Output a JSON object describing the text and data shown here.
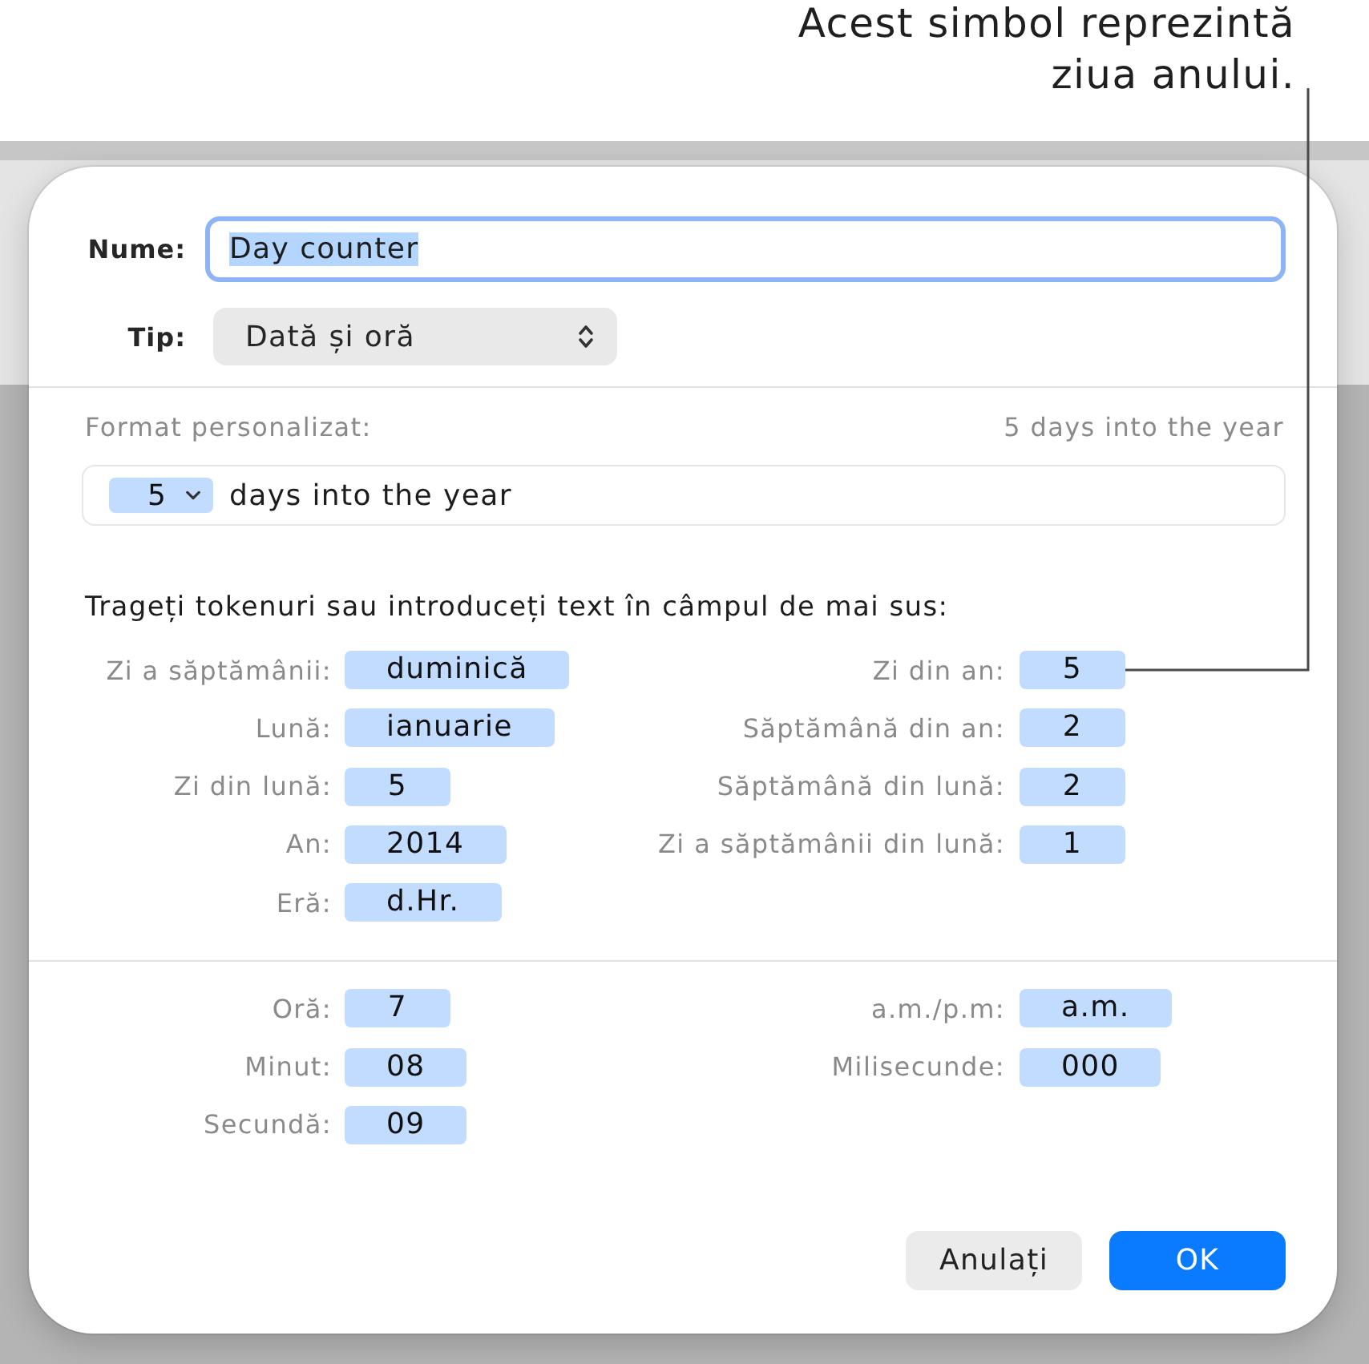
{
  "callout": {
    "text": "Acest simbol reprezintă ziua anului."
  },
  "dialog": {
    "name_field": {
      "label": "Nume:",
      "value": "Day counter",
      "focused": true,
      "text_selected": true
    },
    "type_popup": {
      "label": "Tip:",
      "value": "Dată și oră"
    },
    "format": {
      "label": "Format personalizat:",
      "preview": "5 days into the year",
      "parts": [
        {
          "kind": "token",
          "text": "5"
        },
        {
          "kind": "text",
          "text": "days into the year"
        }
      ]
    },
    "instructions": "Trageți tokenuri sau introduceți text în câmpul de mai sus:",
    "date_tokens": {
      "column_1": [
        {
          "label": "Zi a săptămânii:",
          "value": "duminică"
        },
        {
          "label": "Lună:",
          "value": "ianuarie"
        },
        {
          "label": "Zi din lună:",
          "value": "5"
        },
        {
          "label": "An:",
          "value": "2014"
        },
        {
          "label": "Eră:",
          "value": "d.Hr."
        }
      ],
      "column_2": [
        {
          "label": "Zi din an:",
          "value": "5"
        },
        {
          "label": "Săptămână din an:",
          "value": "2"
        },
        {
          "label": "Săptămână din lună:",
          "value": "2"
        },
        {
          "label": "Zi a săptămânii din lună:",
          "value": "1"
        }
      ]
    },
    "time_tokens": {
      "column_1": [
        {
          "label": "Oră:",
          "value": "7"
        },
        {
          "label": "Minut:",
          "value": "08"
        },
        {
          "label": "Secundă:",
          "value": "09"
        }
      ],
      "column_2": [
        {
          "label": "a.m./p.m:",
          "value": "a.m."
        },
        {
          "label": "Milisecunde:",
          "value": "000"
        }
      ]
    },
    "buttons": [
      {
        "label": "Anulați",
        "kind": "secondary"
      },
      {
        "label": "OK",
        "kind": "primary"
      }
    ]
  }
}
